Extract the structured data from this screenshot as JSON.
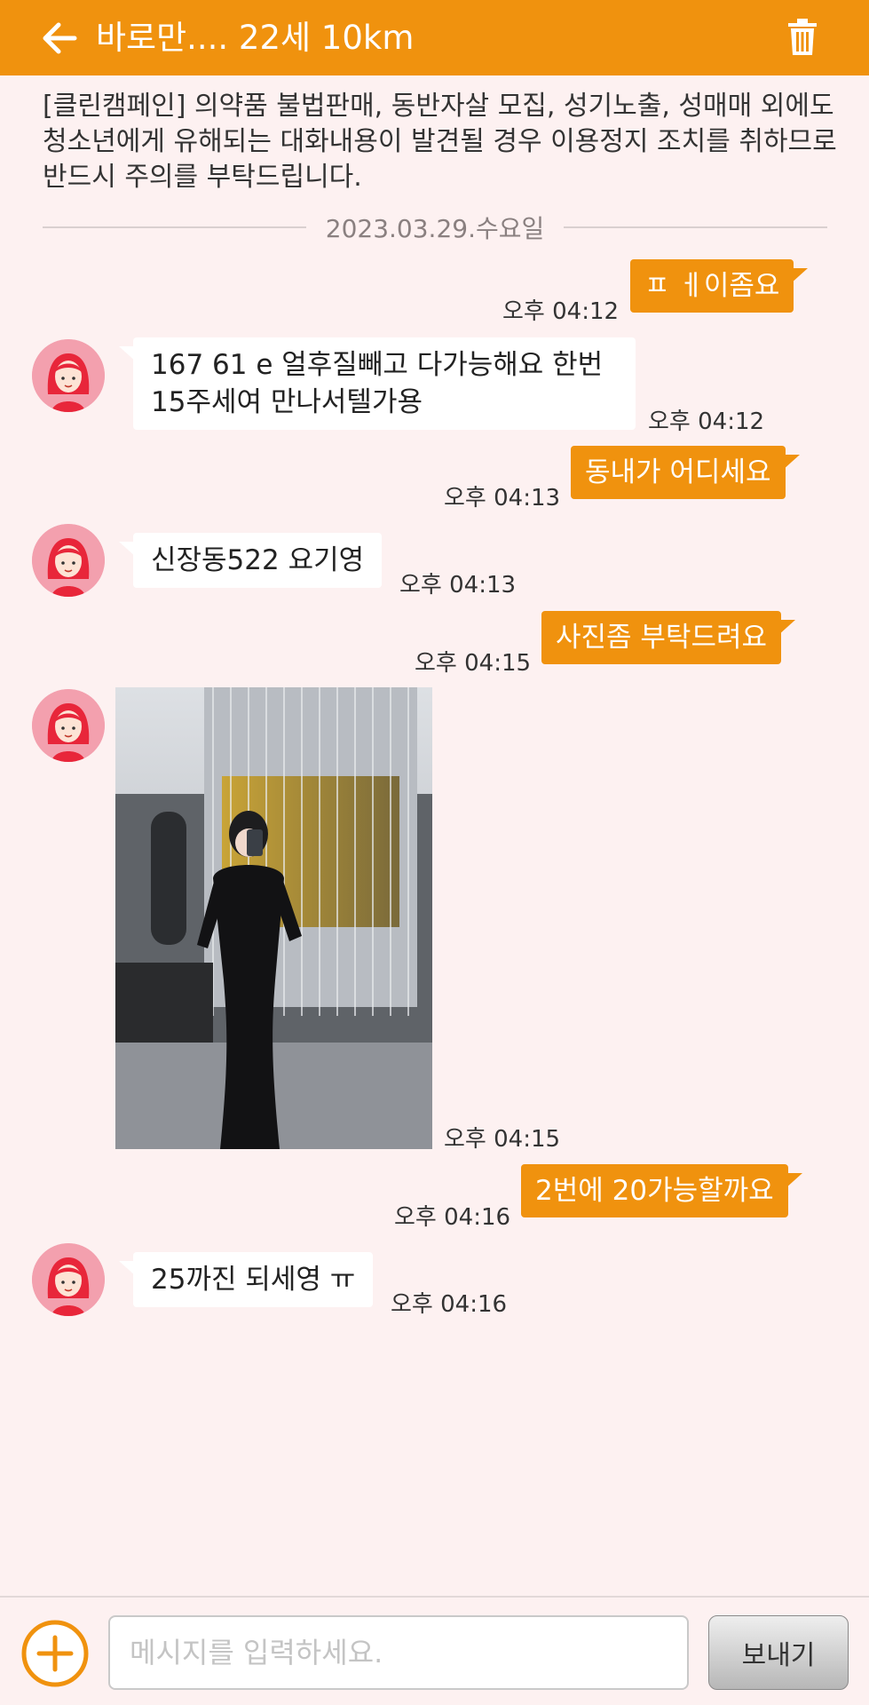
{
  "header": {
    "title": "바로만.... 22세 10km",
    "back_icon": "arrow-left-icon",
    "delete_icon": "trash-icon",
    "background": "#f0920e"
  },
  "notice": "[클린캠페인] 의약품 불법판매, 동반자살 모집, 성기노출, 성매매 외에도 청소년에게 유해되는 대화내용이 발견될 경우 이용정지 조치를 취하므로 반드시 주의를 부탁드립니다.",
  "date_divider": "2023.03.29.수요일",
  "messages": [
    {
      "direction": "sent",
      "text": "ㅍ ㅔ이좀요",
      "time": "오후 04:12"
    },
    {
      "direction": "received",
      "text": "167 61 e 얼후질빼고 다가능해요 한번15주세여   만나서텔가용",
      "time": "오후 04:12"
    },
    {
      "direction": "sent",
      "text": "동내가 어디세요",
      "time": "오후 04:13"
    },
    {
      "direction": "received",
      "text": "신장동522 요기영",
      "time": "오후 04:13"
    },
    {
      "direction": "sent",
      "text": "사진좀 부탁드려요",
      "time": "오후 04:15"
    },
    {
      "direction": "received",
      "type": "photo",
      "time": "오후 04:15"
    },
    {
      "direction": "sent",
      "text": "2번에 20가능할까요",
      "time": "오후 04:16"
    },
    {
      "direction": "received",
      "text": "25까진 되세영 ㅠ",
      "time": "오후 04:16"
    }
  ],
  "composer": {
    "placeholder": "메시지를 입력하세요.",
    "send_label": "보내기",
    "add_icon": "plus-circle-icon"
  },
  "colors": {
    "accent": "#f0920e",
    "background": "#fdf1f1",
    "received_bubble": "#ffffff"
  }
}
